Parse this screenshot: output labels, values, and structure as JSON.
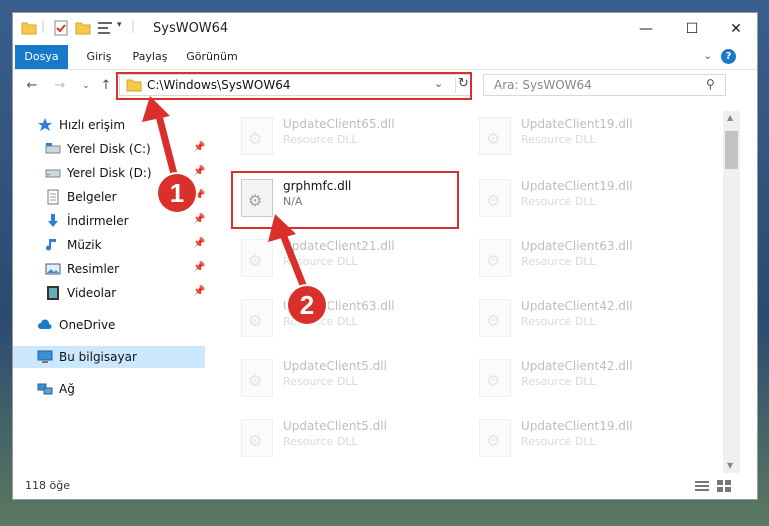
{
  "window": {
    "title": "SysWOW64",
    "controls": [
      "—",
      "☐",
      "✕"
    ]
  },
  "ribbon": {
    "tabs": [
      "Dosya",
      "Giriş",
      "Paylaş",
      "Görünüm"
    ]
  },
  "address": {
    "path": "C:\\Windows\\SysWOW64"
  },
  "search": {
    "placeholder": "Ara: SysWOW64"
  },
  "sidebar": {
    "items": [
      {
        "label": "Hızlı erişim",
        "icon": "star-icon"
      },
      {
        "label": "Yerel Disk (C:)",
        "icon": "drive-icon",
        "pinned": true
      },
      {
        "label": "Yerel Disk (D:)",
        "icon": "drive-icon",
        "pinned": true
      },
      {
        "label": "Belgeler",
        "icon": "documents-icon",
        "pinned": true
      },
      {
        "label": "İndirmeler",
        "icon": "download-icon",
        "pinned": true
      },
      {
        "label": "Müzik",
        "icon": "music-icon",
        "pinned": true
      },
      {
        "label": "Resimler",
        "icon": "pictures-icon",
        "pinned": true
      },
      {
        "label": "Videolar",
        "icon": "video-icon",
        "pinned": true
      },
      {
        "label": "OneDrive",
        "icon": "cloud-icon"
      },
      {
        "label": "Bu bilgisayar",
        "icon": "computer-icon",
        "selected": true
      },
      {
        "label": "Ağ",
        "icon": "network-icon"
      }
    ]
  },
  "files": {
    "left": [
      {
        "name": "UpdateClient65.dll",
        "type": "Resource DLL"
      },
      {
        "name": "grphmfc.dll",
        "type": "N/A",
        "highlight": true
      },
      {
        "name": "UpdateClient21.dll",
        "type": "Resource DLL"
      },
      {
        "name": "UpdateClient63.dll",
        "type": "Resource DLL"
      },
      {
        "name": "UpdateClient5.dll",
        "type": "Resource DLL"
      },
      {
        "name": "UpdateClient5.dll",
        "type": "Resource DLL"
      }
    ],
    "right": [
      {
        "name": "UpdateClient19.dll",
        "type": "Resource DLL"
      },
      {
        "name": "UpdateClient19.dll",
        "type": "Resource DLL"
      },
      {
        "name": "UpdateClient63.dll",
        "type": "Resource DLL"
      },
      {
        "name": "UpdateClient42.dll",
        "type": "Resource DLL"
      },
      {
        "name": "UpdateClient42.dll",
        "type": "Resource DLL"
      },
      {
        "name": "UpdateClient19.dll",
        "type": "Resource DLL"
      }
    ]
  },
  "status": {
    "count": "118 öğe"
  },
  "annotations": {
    "step1": "1",
    "step2": "2"
  },
  "colors": {
    "accent": "#1979ca",
    "highlight": "#d9302c",
    "selected": "#cce8ff"
  }
}
